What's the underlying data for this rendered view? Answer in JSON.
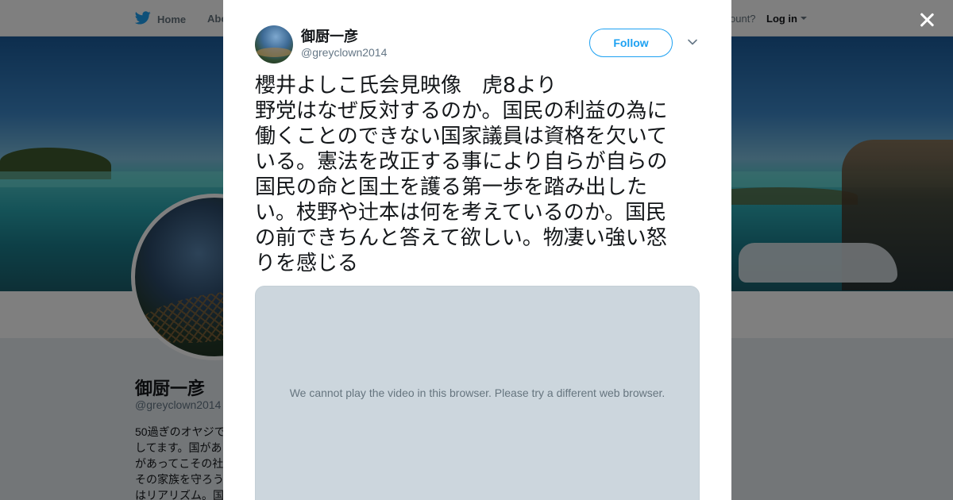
{
  "topnav": {
    "home_label": "Home",
    "about_label": "Abo",
    "account_label": "ccount?",
    "login_label": "Log in"
  },
  "background_profile": {
    "name": "御厨一彦",
    "handle": "@greyclown2014",
    "bio_lines": [
      "50過ぎのオヤジで",
      "してます。国があ",
      "があってこその社",
      "その家族を守ろう",
      "はリアリズム。国"
    ]
  },
  "tweet": {
    "display_name": "御厨一彦",
    "screen_name": "@greyclown2014",
    "follow_label": "Follow",
    "text_lines": [
      "櫻井よしこ氏会見映像　虎8より",
      "野党はなぜ反対するのか。国民の利益の為に",
      "働くことのできない国家議員は資格を欠いて",
      "いる。憲法を改正する事により自らが自らの",
      "国民の命と国土を護る第一歩を踏み出した",
      "い。枝野や辻本は何を考えているのか。国民",
      "の前できちんと答えて欲しい。物凄い強い怒",
      "りを感じる"
    ],
    "media_message": "We cannot play the video in this browser. Please try a different web browser."
  },
  "icons": {
    "twitter_bird": "twitter-bird-icon",
    "close": "close-icon",
    "chevron": "chevron-down-icon"
  },
  "colors": {
    "accent": "#1da1f2",
    "overlay": "rgba(0,0,0,0.5)",
    "media_bg": "#ccd6dd"
  }
}
